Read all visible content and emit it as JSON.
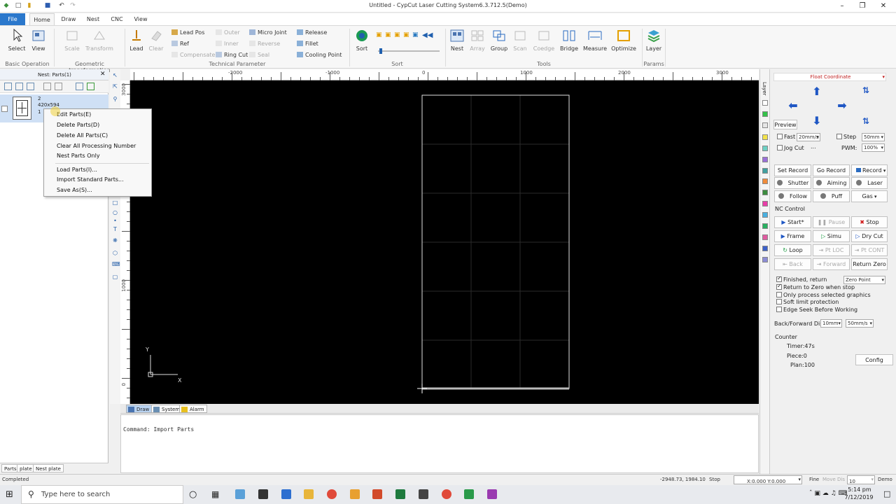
{
  "window": {
    "title": "Untitled - CypCut Laser Cutting System6.3.712.5(Demo)"
  },
  "tabs": [
    "File",
    "Home",
    "Draw",
    "Nest",
    "CNC",
    "View"
  ],
  "ribbon": {
    "basic": {
      "select": "Select",
      "view": "View",
      "group": "Basic Operation"
    },
    "geo": {
      "scale": "Scale",
      "transform": "Transform",
      "group": "Geometric transformation"
    },
    "tech": {
      "lead": "Lead",
      "clear": "Clear",
      "lead_pos": "Lead Pos",
      "ref": "Ref",
      "compensate": "Compensate",
      "outer": "Outer",
      "inner": "Inner",
      "reverse": "Reverse",
      "ring_cut": "Ring Cut",
      "seal": "Seal",
      "micro_joint": "Micro Joint",
      "release": "Release",
      "fillet": "Fillet",
      "cooling_point": "Cooling Point",
      "group": "Technical Parameter"
    },
    "sort": {
      "sort": "Sort",
      "group": "Sort"
    },
    "tools": {
      "nest": "Nest",
      "array": "Array",
      "group_btn": "Group",
      "scan": "Scan",
      "coedge": "Coedge",
      "bridge": "Bridge",
      "measure": "Measure",
      "optimize": "Optimize",
      "group": "Tools"
    },
    "params": {
      "layer": "Layer",
      "group": "Params"
    }
  },
  "left": {
    "header": "Nest: Parts(1)",
    "part": {
      "num": "2",
      "size": "420x594",
      "count": "1"
    },
    "bottom_tabs": [
      "Parts",
      "plate",
      "Nest plate"
    ]
  },
  "context_menu": [
    "Edit Parts(E)",
    "Delete Parts(D)",
    "Delete All Parts(C)",
    "Clear All Processing Number",
    "Nest Parts Only",
    "Load Parts(I)...",
    "Import Standard Parts...",
    "Save As(S)..."
  ],
  "ruler": {
    "h": [
      "-2000",
      "-1000",
      "0",
      "1000",
      "2000",
      "3000"
    ],
    "v": [
      "3000",
      "1000",
      "0"
    ]
  },
  "canvas": {
    "y_label": "Y",
    "x_label": "X"
  },
  "cmd": {
    "tabs": [
      "Draw",
      "System",
      "Alarm"
    ],
    "text": "Command: Import Parts"
  },
  "layer_label": "Layer",
  "layer_colors": [
    "#ffffff",
    "#35c24a",
    "#e6e6e6",
    "#f2e24a",
    "#6dd0c4",
    "#9a6fd9",
    "#3fa0a0",
    "#f08b3a",
    "#3d8d3f",
    "#e83fa8",
    "#4ab0e0",
    "#28b060",
    "#e05aa0",
    "#3b60c9",
    "#8c8cd6"
  ],
  "right": {
    "coord": "Float Coordinate",
    "preview": "Preview",
    "fast": "Fast",
    "fast_val": "20mm/s",
    "step": "Step",
    "step_val": "50mm",
    "jog": "Jog Cut",
    "jog_val": "...",
    "pwm": "PWM:",
    "pwm_val": "100%",
    "set_record": "Set Record",
    "go_record": "Go Record",
    "record": "Record",
    "shutter": "Shutter",
    "aiming": "Aiming",
    "laser": "Laser",
    "follow": "Follow",
    "puff": "Puff",
    "gas": "Gas",
    "nc": "NC Control",
    "start": "Start*",
    "pause": "Pause",
    "stop": "Stop",
    "frame": "Frame",
    "simu": "Simu",
    "dry_cut": "Dry Cut",
    "loop": "Loop",
    "pt_loc": "Pt LOC",
    "pt_cont": "Pt CONT",
    "back": "Back",
    "forward": "Forward",
    "return_zero": "Return Zero",
    "finished": "Finished, return",
    "zero_point": "Zero Point",
    "return_stop": "Return to Zero when stop",
    "only_sel": "Only process selected graphics",
    "soft_limit": "Soft limit protection",
    "edge_seek": "Edge Seek Before Working",
    "bf_label": "Back/Forward Dis:",
    "bf_val1": "10mm",
    "bf_val2": "50mm/s",
    "counter": "Counter",
    "timer": "Timer:47s",
    "piece": "Piece:0",
    "plan": "Plan:100",
    "config": "Config"
  },
  "status": {
    "left": "Completed",
    "coords": "-2948.73, 1984.10",
    "state": "Stop",
    "xy": "X:0.000 Y:0.000",
    "fine": "Fine",
    "move_dis": "Move Dis",
    "move_val": "10",
    "demo": "Demo"
  },
  "taskbar": {
    "search": "Type here to search",
    "time": "5:14 pm",
    "date": "7/12/2019"
  }
}
